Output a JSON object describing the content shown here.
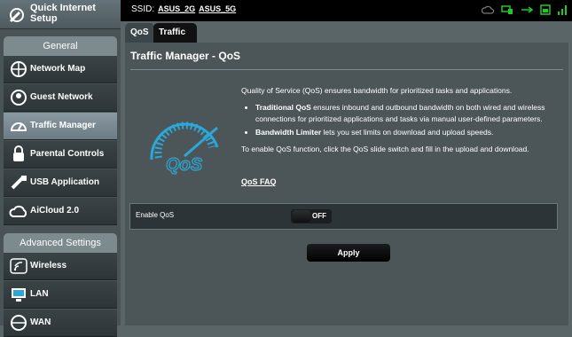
{
  "sidebar": {
    "quick_setup": "Quick Internet Setup",
    "sections": [
      {
        "title": "General"
      },
      {
        "title": "Advanced Settings"
      }
    ],
    "general_items": [
      {
        "label": "Network Map"
      },
      {
        "label": "Guest Network"
      },
      {
        "label": "Traffic Manager"
      },
      {
        "label": "Parental Controls"
      },
      {
        "label": "USB Application"
      },
      {
        "label": "AiCloud 2.0"
      }
    ],
    "advanced_items": [
      {
        "label": "Wireless"
      },
      {
        "label": "LAN"
      },
      {
        "label": "WAN"
      }
    ]
  },
  "topbar": {
    "ssid_label": "SSID:",
    "ssids": [
      "ASUS_2G",
      "ASUS_5G"
    ]
  },
  "tabs": {
    "qos": "QoS",
    "traffic_monitor": "Traffic Monitor"
  },
  "panel": {
    "title": "Traffic Manager - QoS",
    "intro": "Quality of Service (QoS) ensures bandwidth for prioritized tasks and applications.",
    "bullet1_bold": "Traditional QoS",
    "bullet1_text": " ensures inbound and outbound bandwidth on both wired and wireless connections for prioritized applications and tasks via manual user-defined parameters.",
    "bullet2_bold": "Bandwidth Limiter",
    "bullet2_text": " lets you set limits on download and upload speeds.",
    "instructions": "To enable QoS function, click the QoS slide switch and fill in the upload and download.",
    "faq": "QoS FAQ",
    "enable_label": "Enable QoS",
    "toggle_state": "OFF",
    "apply": "Apply"
  },
  "colors": {
    "accent": "#2ba8d8",
    "status_green": "#22c82a"
  }
}
